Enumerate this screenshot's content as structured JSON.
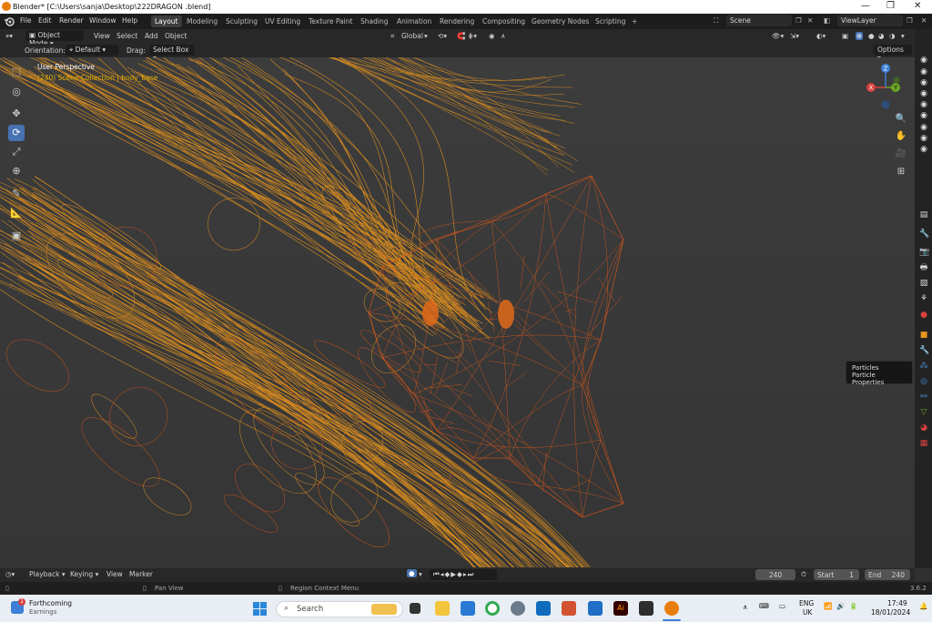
{
  "window": {
    "title": "Blender* [C:\\Users\\sanja\\Desktop\\222DRAGON .blend]",
    "minimize": "—",
    "maximize": "❐",
    "close": "✕"
  },
  "menu": [
    "File",
    "Edit",
    "Render",
    "Window",
    "Help"
  ],
  "workspaces": [
    "Layout",
    "Modeling",
    "Sculpting",
    "UV Editing",
    "Texture Paint",
    "Shading",
    "Animation",
    "Rendering",
    "Compositing",
    "Geometry Nodes",
    "Scripting"
  ],
  "add_workspace": "+",
  "scene": {
    "label": "Scene",
    "viewlayer": "ViewLayer"
  },
  "header": {
    "mode": "Object Mode",
    "view": "View",
    "select": "Select",
    "add": "Add",
    "object": "Object",
    "transform": "Global",
    "options": "Options"
  },
  "toolsettings": {
    "orientation_label": "Orientation:",
    "orientation_value": "Default",
    "drag_label": "Drag:",
    "drag_value": "Select Box"
  },
  "viewport": {
    "perspective": "User Perspective",
    "collection": "(240) Scene Collection | body_base",
    "accent_wire": "#e8951e",
    "accent_wire2": "#d9581b"
  },
  "gizmo": {
    "x": "X",
    "y": "Y",
    "z": "Z"
  },
  "tooltip": {
    "title": "Particles",
    "subtitle": "Particle Properties"
  },
  "timeline": {
    "playback": "Playback",
    "keying": "Keying",
    "view": "View",
    "marker": "Marker",
    "current_frame": "240",
    "start_label": "Start",
    "start": "1",
    "end_label": "End",
    "end": "240"
  },
  "statusbar": {
    "pan": "Pan View",
    "context": "Region Context Menu",
    "version": "3.6.2"
  },
  "taskbar": {
    "news_title": "Forthcoming",
    "news_sub": "Earnings",
    "news_badge": "1",
    "search": "Search",
    "lang": "ENG",
    "region": "UK",
    "time": "17:49",
    "date": "18/01/2024"
  }
}
